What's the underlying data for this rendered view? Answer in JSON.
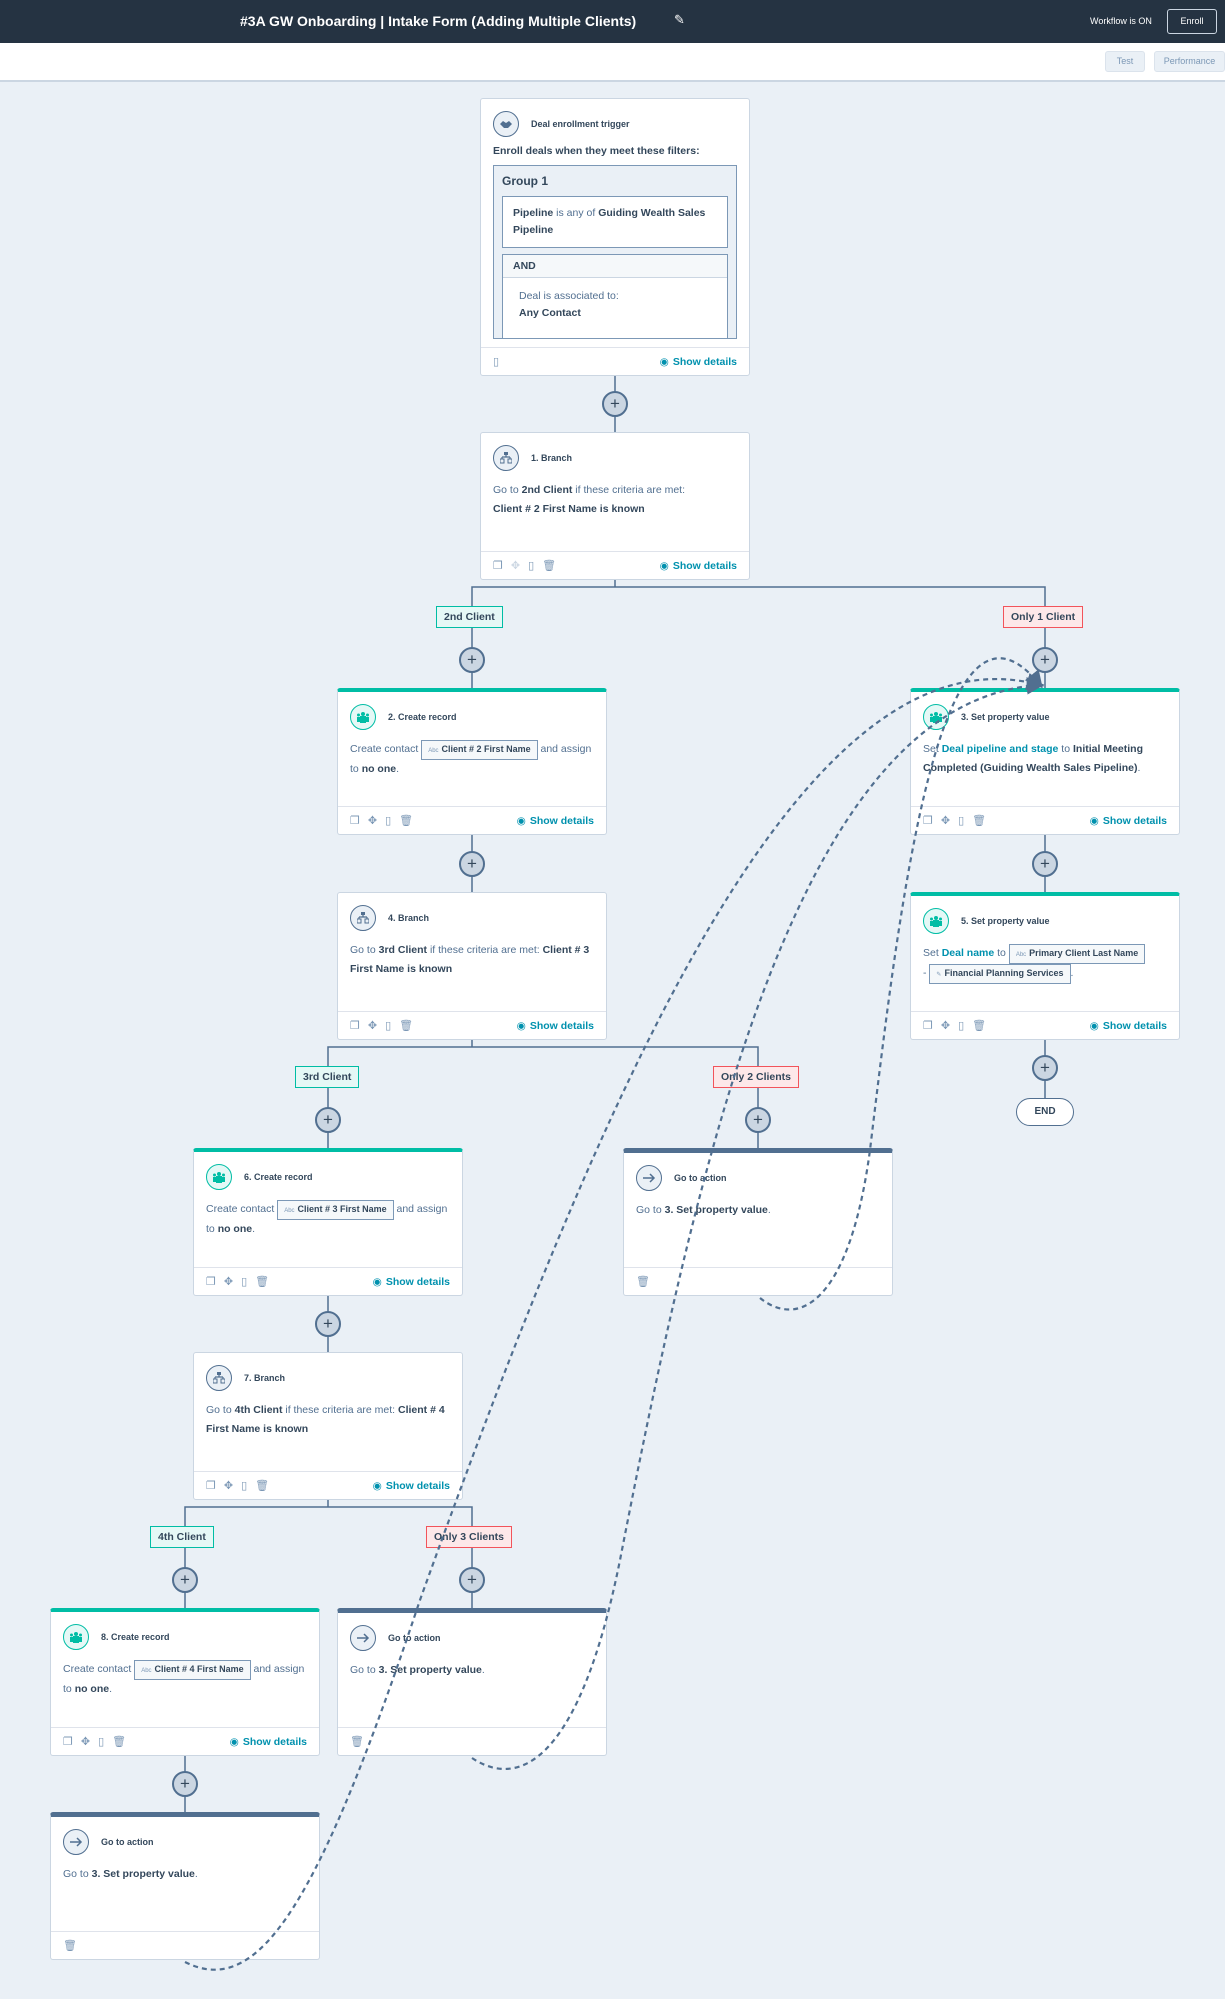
{
  "header": {
    "title": "#3A GW Onboarding | Intake Form (Adding Multiple Clients)",
    "edit_icon": "pencil-icon",
    "status": "Workflow is ON",
    "enroll_label": "Enroll"
  },
  "subbar": {
    "test_label": "Test",
    "performance_label": "Performance"
  },
  "common": {
    "show_details": "Show details",
    "end_label": "END"
  },
  "trigger": {
    "title": "Deal enrollment trigger",
    "icon": "handshake-icon",
    "intro": "Enroll deals when they meet these filters:",
    "group_title": "Group 1",
    "filter1_prop": "Pipeline",
    "filter1_op": " is any of ",
    "filter1_value": "Guiding Wealth Sales Pipeline",
    "and_label": "AND",
    "filter2_text": "Deal is associated to:",
    "filter2_value": "Any Contact"
  },
  "steps": {
    "s1": {
      "title": "1. Branch",
      "icon": "branch-icon",
      "pre": "Go to ",
      "target": "2nd Client",
      "mid": " if these criteria are met:",
      "criteria": "Client # 2 First Name is known"
    },
    "s2": {
      "title": "2. Create record",
      "icon": "contacts-icon",
      "pre": "Create contact ",
      "token_type": "Abc",
      "token": "Client # 2 First Name",
      "post": " and assign to ",
      "assignee": "no one",
      "end": "."
    },
    "s3": {
      "title": "3. Set property value",
      "icon": "contacts-icon",
      "pre": "Set ",
      "prop": "Deal pipeline and stage",
      "mid": " to ",
      "value": "Initial Meeting Completed (Guiding Wealth Sales Pipeline)",
      "end": "."
    },
    "s4": {
      "title": "4. Branch",
      "icon": "branch-icon",
      "pre": "Go to ",
      "target": "3rd Client",
      "mid": " if these criteria are met: ",
      "criteria": "Client # 3 First Name is known"
    },
    "s5": {
      "title": "5. Set property value",
      "icon": "contacts-icon",
      "pre": "Set ",
      "prop": "Deal name",
      "mid": " to ",
      "token1_type": "Abc",
      "token1": "Primary Client Last Name",
      "sep": " - ",
      "token2": "Financial Planning Services",
      "end": "."
    },
    "s6": {
      "title": "6. Create record",
      "icon": "contacts-icon",
      "pre": "Create contact ",
      "token_type": "Abc",
      "token": "Client # 3 First Name",
      "post": " and assign to ",
      "assignee": "no one",
      "end": "."
    },
    "s7": {
      "title": "7. Branch",
      "icon": "branch-icon",
      "pre": "Go to ",
      "target": "4th Client",
      "mid": " if these criteria are met: ",
      "criteria": "Client # 4 First Name is known"
    },
    "s8": {
      "title": "8. Create record",
      "icon": "contacts-icon",
      "pre": "Create contact ",
      "token_type": "Abc",
      "token": "Client # 4 First Name",
      "post": " and assign to ",
      "assignee": "no one",
      "end": "."
    },
    "goto": {
      "title": "Go to action",
      "icon": "arrow-right-icon",
      "pre": "Go to ",
      "target": "3. Set property value",
      "end": "."
    }
  },
  "branches": {
    "b1_yes": "2nd Client",
    "b1_no": "Only 1 Client",
    "b4_yes": "3rd Client",
    "b4_no": "Only 2 Clients",
    "b7_yes": "4th Client",
    "b7_no": "Only 3 Clients"
  },
  "colors": {
    "header_bg": "#253342",
    "canvas_bg": "#eaf0f6",
    "accent_teal": "#00bda5",
    "link": "#0091ae",
    "branch_no": "#f2545b",
    "connector": "#516f90"
  }
}
